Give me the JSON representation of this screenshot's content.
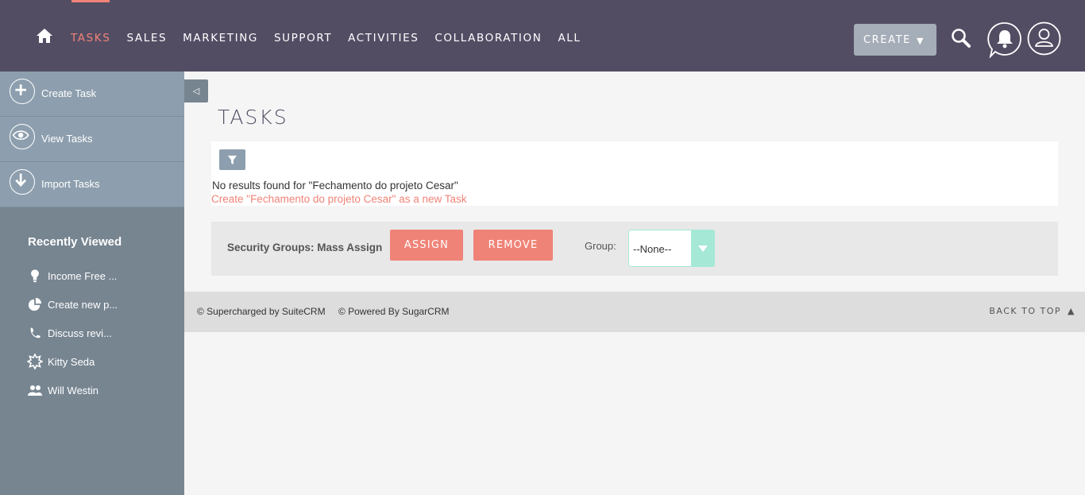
{
  "nav": {
    "tabs": [
      {
        "label": "TASKS",
        "active": true
      },
      {
        "label": "SALES"
      },
      {
        "label": "MARKETING"
      },
      {
        "label": "SUPPORT"
      },
      {
        "label": "ACTIVITIES"
      },
      {
        "label": "COLLABORATION"
      },
      {
        "label": "ALL"
      }
    ],
    "create_label": "CREATE",
    "create_caret": "▼"
  },
  "sidebar": {
    "actions": [
      {
        "label": "Create Task",
        "icon": "plus-icon"
      },
      {
        "label": "View Tasks",
        "icon": "eye-icon"
      },
      {
        "label": "Import Tasks",
        "icon": "download-icon"
      }
    ],
    "recent_title": "Recently Viewed",
    "recent_items": [
      {
        "label": "Income Free ...",
        "icon": "lightbulb-icon"
      },
      {
        "label": "Create new p...",
        "icon": "pie-chart-icon"
      },
      {
        "label": "Discuss revi...",
        "icon": "phone-icon"
      },
      {
        "label": "Kitty Seda",
        "icon": "badge-icon"
      },
      {
        "label": "Will Westin",
        "icon": "people-icon"
      }
    ]
  },
  "main": {
    "collapse_glyph": "◁",
    "title": "TASKS",
    "no_results": "No results found for \"Fechamento do projeto Cesar\"",
    "create_link": "Create \"Fechamento do projeto Cesar\" as a new Task",
    "security": {
      "label": "Security Groups: Mass Assign",
      "assign": "ASSIGN",
      "remove": "REMOVE",
      "group_label": "Group:",
      "group_value": "--None--"
    }
  },
  "footer": {
    "supercharged": "© Supercharged by SuiteCRM",
    "powered": "© Powered By SugarCRM",
    "back_to_top": "BACK TO TOP",
    "back_to_top_glyph": "▲"
  },
  "colors": {
    "navbar": "#534d64",
    "accent": "#f08377",
    "sidebar": "#778591",
    "sidebar_actions": "#8d9fae",
    "select_accent": "#a5e8d6"
  }
}
